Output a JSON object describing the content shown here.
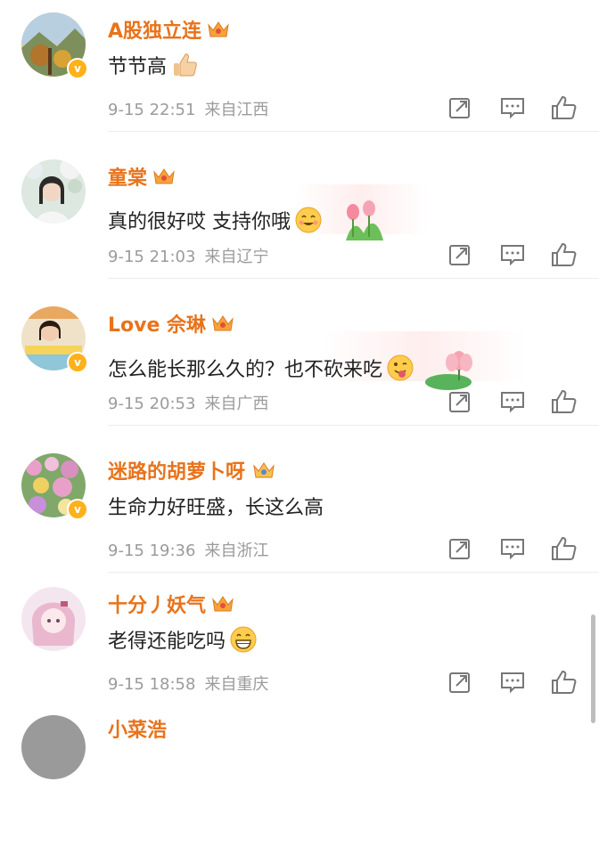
{
  "comments": [
    {
      "username": "A股独立连",
      "text": "节节高",
      "date": "9-15 22:51",
      "location": "来自江西",
      "emoji": "thumbs-up-emoji"
    },
    {
      "username": "童棠",
      "text": "真的很好哎 支持你哦",
      "date": "9-15 21:03",
      "location": "来自辽宁",
      "emoji": "blushing-face-emoji"
    },
    {
      "username": "Love 佘琳",
      "text": "怎么能长那么久的？也不砍来吃",
      "date": "9-15 20:53",
      "location": "来自广西",
      "emoji": "winking-tongue-emoji"
    },
    {
      "username": "迷路的胡萝卜呀",
      "text": "生命力好旺盛，长这么高",
      "date": "9-15 19:36",
      "location": "来自浙江",
      "emoji": ""
    },
    {
      "username": "十分丿妖气",
      "text": "老得还能吃吗",
      "date": "9-15 18:58",
      "location": "来自重庆",
      "emoji": "grinning-face-emoji"
    },
    {
      "username": "小菜浩",
      "text": "",
      "date": "",
      "location": "",
      "emoji": ""
    }
  ],
  "colors": {
    "username": "#e8731b",
    "meta": "#9b9b9b",
    "icon": "#777777",
    "badge": "#ffb11b"
  },
  "icons": [
    "share-icon",
    "comment-icon",
    "like-icon",
    "vip-crown-icon",
    "verified-badge-icon"
  ]
}
